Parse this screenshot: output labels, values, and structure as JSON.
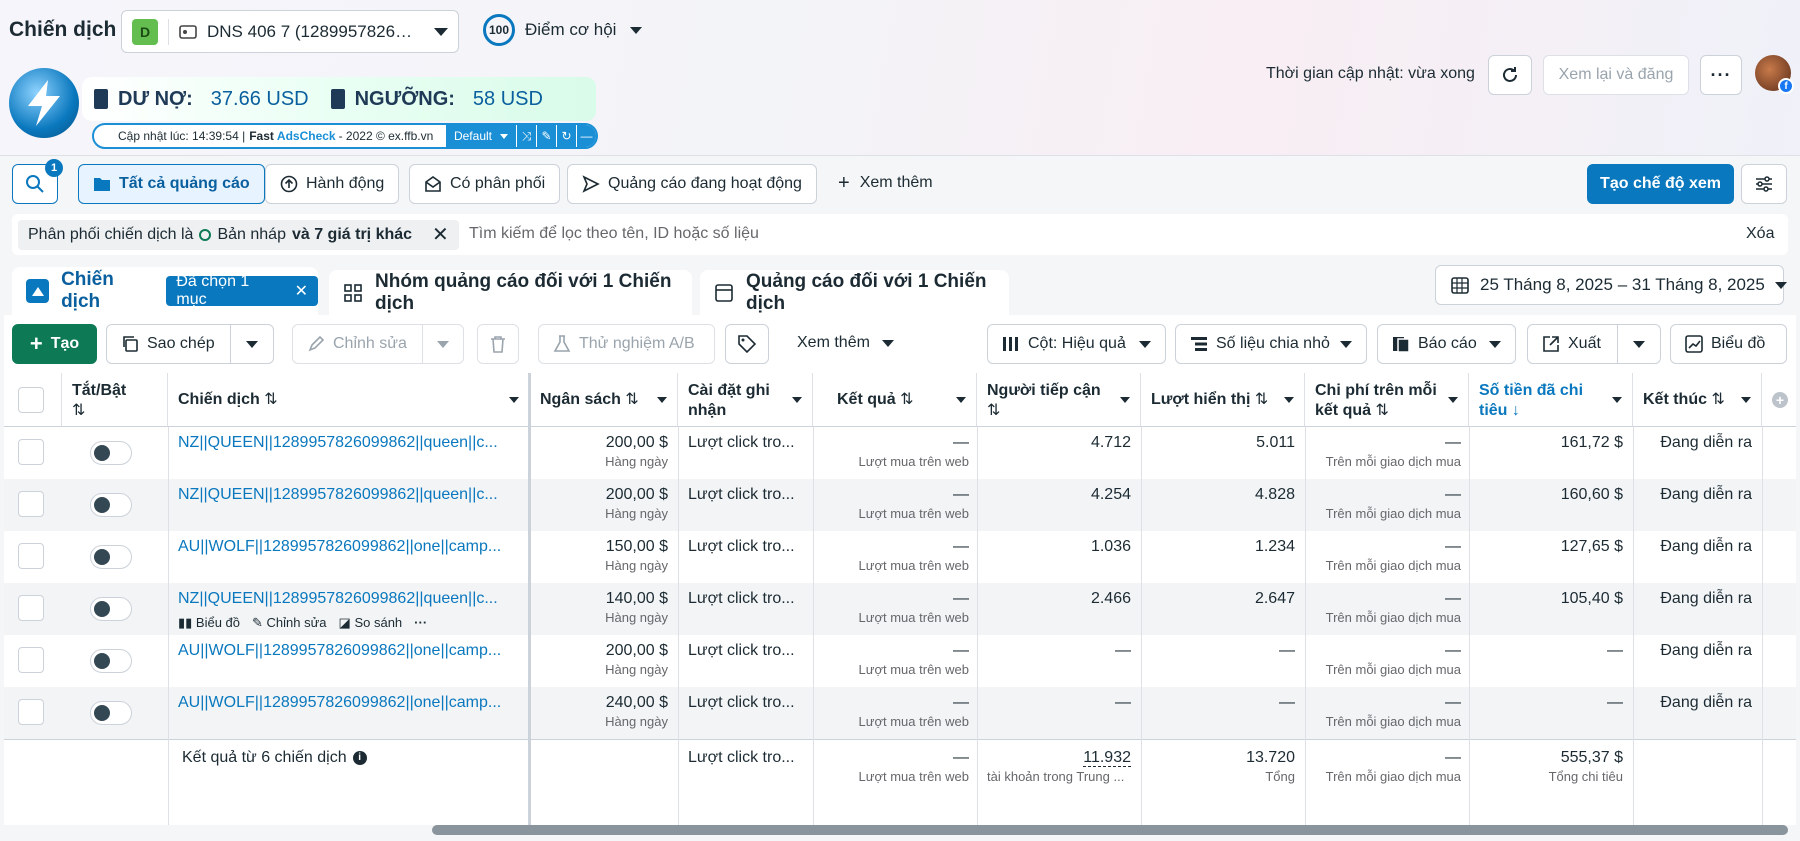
{
  "header": {
    "title": "Chiến dịch",
    "account_badge": "D",
    "account_name": "DNS 406 7 (1289957826…",
    "score": "100",
    "opportunity_label": "Điểm cơ hội",
    "update_time": "Thời gian cập nhật: vừa xong",
    "review_button": "Xem lại và đăng"
  },
  "addon": {
    "debt_label": "DƯ NỢ:",
    "debt_value": "37.66 USD",
    "threshold_label": "NGƯỠNG:",
    "threshold_value": "58 USD",
    "updated_prefix": "Cập nhật lúc: 14:39:54 |",
    "brand_a": "Fast",
    "brand_b": "AdsCheck",
    "suffix": "- 2022 © ex.ffb.vn",
    "select_value": "Default"
  },
  "filters": {
    "search_badge": "1",
    "tabs": [
      "Tất cả quảng cáo",
      "Hành động",
      "Có phân phối",
      "Quảng cáo đang hoạt động",
      "Xem thêm"
    ],
    "create_view": "Tạo chế độ xem",
    "chip_text": "Phân phối chiến dịch là",
    "chip_value": "Bản nháp",
    "chip_more": "và 7 giá trị khác",
    "search_placeholder": "Tìm kiếm để lọc theo tên, ID hoặc số liệu",
    "clear": "Xóa"
  },
  "level_tabs": {
    "campaign": "Chiến dịch",
    "selected": "Đã chọn 1 mục",
    "adsets": "Nhóm quảng cáo đối với 1 Chiến dịch",
    "ads": "Quảng cáo đối với 1 Chiến dịch",
    "date_range": "25 Tháng 8, 2025 – 31 Tháng 8, 2025"
  },
  "toolbar": {
    "create": "Tạo",
    "copy": "Sao chép",
    "edit": "Chỉnh sửa",
    "ab_test": "Thử nghiệm A/B",
    "more": "Xem thêm",
    "columns": "Cột: Hiệu quả",
    "breakdown": "Số liệu chia nhỏ",
    "reports": "Báo cáo",
    "export": "Xuất",
    "chart": "Biểu đồ"
  },
  "table": {
    "headers": [
      "Tắt/Bật",
      "Chiến dịch",
      "Ngân sách",
      "Cài đặt ghi nhận",
      "Kết quả",
      "Người tiếp cận",
      "Lượt hiển thị",
      "Chi phí trên mỗi kết quả",
      "Số tiền đã chi tiêu",
      "Kết thúc"
    ],
    "rows": [
      {
        "name": "NZ||QUEEN||1289957826099862||queen||c...",
        "budget": "200,00 $",
        "budget_sub": "Hàng ngày",
        "attribution": "Lượt click tro...",
        "result": "—",
        "result_sub": "Lượt mua trên web",
        "reach": "4.712",
        "impressions": "5.011",
        "cpr": "—",
        "cpr_sub": "Trên mỗi giao dịch mua",
        "spent": "161,72 $",
        "end": "Đang diễn ra"
      },
      {
        "name": "NZ||QUEEN||1289957826099862||queen||c...",
        "budget": "200,00 $",
        "budget_sub": "Hàng ngày",
        "attribution": "Lượt click tro...",
        "result": "—",
        "result_sub": "Lượt mua trên web",
        "reach": "4.254",
        "impressions": "4.828",
        "cpr": "—",
        "cpr_sub": "Trên mỗi giao dịch mua",
        "spent": "160,60 $",
        "end": "Đang diễn ra"
      },
      {
        "name": "AU||WOLF||1289957826099862||one||camp...",
        "budget": "150,00 $",
        "budget_sub": "Hàng ngày",
        "attribution": "Lượt click tro...",
        "result": "—",
        "result_sub": "Lượt mua trên web",
        "reach": "1.036",
        "impressions": "1.234",
        "cpr": "—",
        "cpr_sub": "Trên mỗi giao dịch mua",
        "spent": "127,65 $",
        "end": "Đang diễn ra"
      },
      {
        "name": "NZ||QUEEN||1289957826099862||queen||c...",
        "budget": "140,00 $",
        "budget_sub": "Hàng ngày",
        "attribution": "Lượt click tro...",
        "result": "—",
        "result_sub": "Lượt mua trên web",
        "reach": "2.466",
        "impressions": "2.647",
        "cpr": "—",
        "cpr_sub": "Trên mỗi giao dịch mua",
        "spent": "105,40 $",
        "end": "Đang diễn ra"
      },
      {
        "name": "AU||WOLF||1289957826099862||one||camp...",
        "budget": "200,00 $",
        "budget_sub": "Hàng ngày",
        "attribution": "Lượt click tro...",
        "result": "—",
        "result_sub": "Lượt mua trên web",
        "reach": "—",
        "impressions": "—",
        "cpr": "—",
        "cpr_sub": "Trên mỗi giao dịch mua",
        "spent": "—",
        "end": "Đang diễn ra"
      },
      {
        "name": "AU||WOLF||1289957826099862||one||camp...",
        "budget": "240,00 $",
        "budget_sub": "Hàng ngày",
        "attribution": "Lượt click tro...",
        "result": "—",
        "result_sub": "Lượt mua trên web",
        "reach": "—",
        "impressions": "—",
        "cpr": "—",
        "cpr_sub": "Trên mỗi giao dịch mua",
        "spent": "—",
        "end": "Đang diễn ra"
      }
    ],
    "row_actions": [
      "Biểu đồ",
      "Chỉnh sửa",
      "So sánh"
    ],
    "summary": {
      "label": "Kết quả từ 6 chiến dịch",
      "attribution": "Lượt click tro...",
      "result": "—",
      "result_sub": "Lượt mua trên web",
      "reach": "11.932",
      "reach_sub": "tài khoản trong Trung ...",
      "impressions": "13.720",
      "impressions_sub": "Tổng",
      "cpr": "—",
      "cpr_sub": "Trên mỗi giao dịch mua",
      "spent": "555,37 $",
      "spent_sub": "Tổng chi tiêu"
    }
  }
}
